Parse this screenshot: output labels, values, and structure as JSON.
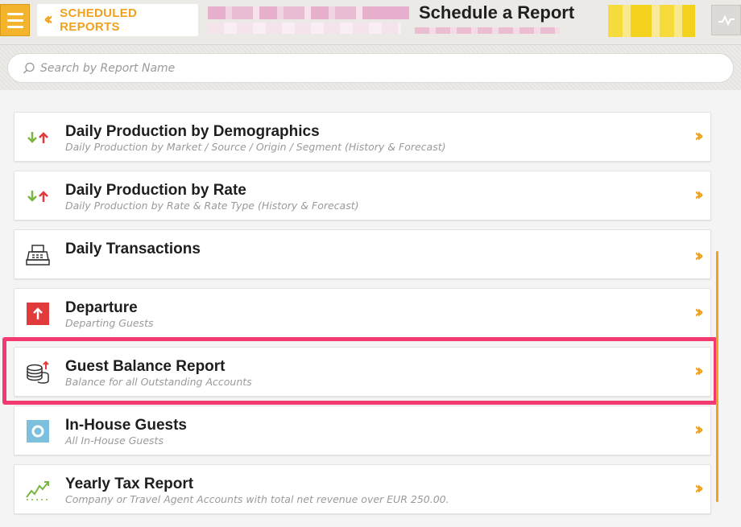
{
  "header": {
    "back_label": "SCHEDULED REPORTS",
    "title": "Schedule a Report"
  },
  "search": {
    "placeholder": "Search by Report Name"
  },
  "reports": [
    {
      "name": "Daily Production by Demographics",
      "desc": "Daily Production by Market / Source / Origin / Segment (History & Forecast)",
      "icon": "arrows-up-down-icon"
    },
    {
      "name": "Daily Production by Rate",
      "desc": "Daily Production by Rate & Rate Type (History & Forecast)",
      "icon": "arrows-up-down-icon"
    },
    {
      "name": "Daily Transactions",
      "desc": "",
      "icon": "cash-register-icon"
    },
    {
      "name": "Departure",
      "desc": "Departing Guests",
      "icon": "departure-arrow-icon"
    },
    {
      "name": "Guest Balance Report",
      "desc": "Balance for all Outstanding Accounts",
      "icon": "coins-icon"
    },
    {
      "name": "In-House Guests",
      "desc": "All In-House Guests",
      "icon": "in-house-icon"
    },
    {
      "name": "Yearly Tax Report",
      "desc": "Company or Travel Agent Accounts with total net revenue over EUR 250.00.",
      "icon": "trend-chart-icon"
    }
  ],
  "colors": {
    "accent": "#f0a21c",
    "highlight": "#f23a70",
    "green": "#7ab542",
    "red": "#e03a3a",
    "blue": "#7cc0dd"
  }
}
